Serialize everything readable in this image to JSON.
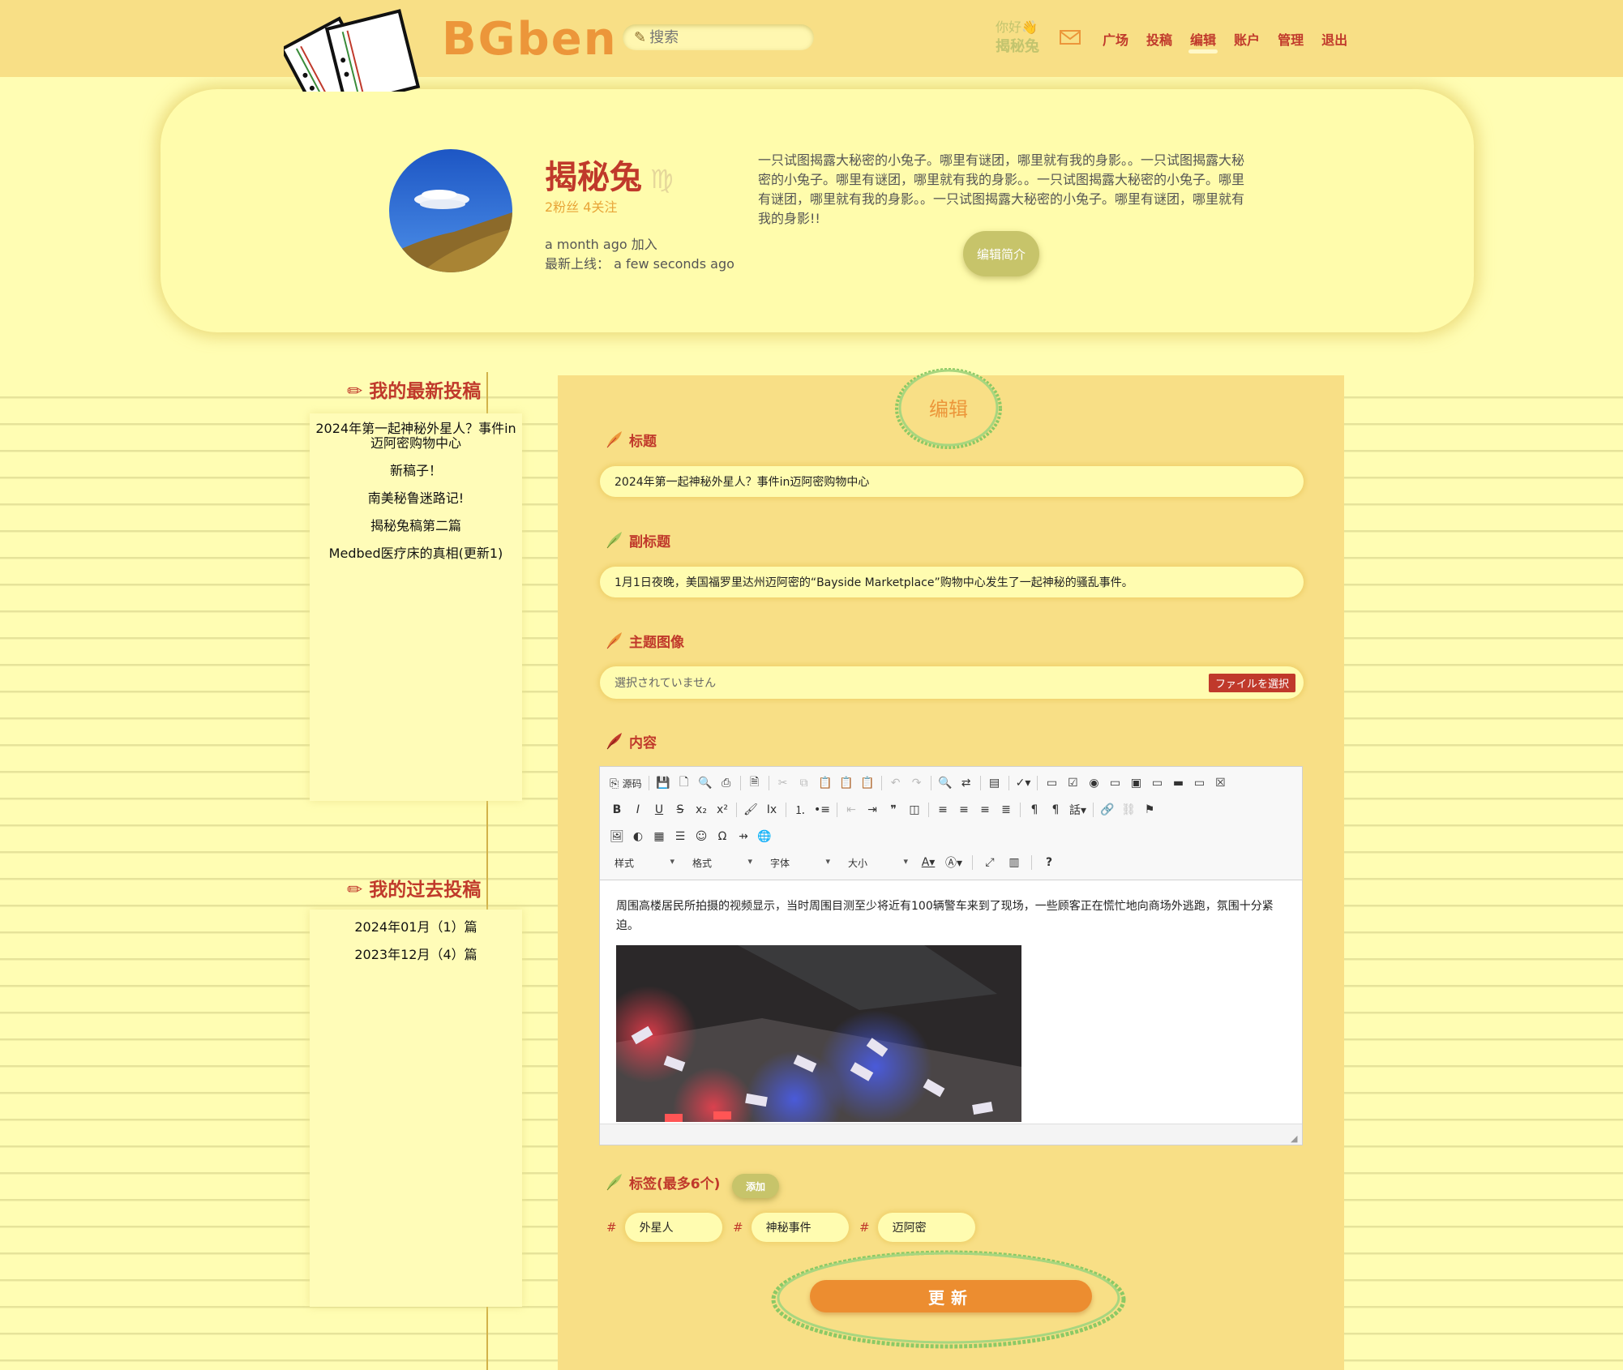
{
  "colors": {
    "page_bg": "#fffdb3",
    "header_bg": "#f8df86",
    "editor_bg": "#f8df86",
    "accent_red": "#c0392b",
    "accent_orange": "#ec963a",
    "olive_button": "#c7c46a",
    "green_scribble": "#8cc965"
  },
  "header": {
    "logo_text": "BGben",
    "search_placeholder": "搜索",
    "greeting": "你好👋",
    "username": "揭秘兔",
    "mail_icon": "envelope-icon",
    "nav": [
      {
        "label": "广场"
      },
      {
        "label": "投稿"
      },
      {
        "label": "编辑",
        "active": true
      },
      {
        "label": "账户"
      },
      {
        "label": "管理"
      },
      {
        "label": "退出"
      }
    ]
  },
  "profile": {
    "name": "揭秘兔",
    "zodiac": "♍",
    "stats": "2粉丝 4关注",
    "joined": "a month ago 加入",
    "last_online_label": "最新上线：",
    "last_online_value": "a few seconds ago",
    "bio": "一只试图揭露大秘密的小兔子。哪里有谜团，哪里就有我的身影。。一只试图揭露大秘密的小兔子。哪里有谜团，哪里就有我的身影。。一只试图揭露大秘密的小兔子。哪里有谜团，哪里就有我的身影。。一只试图揭露大秘密的小兔子。哪里有谜团，哪里就有我的身影!!",
    "edit_bio_label": "编辑简介"
  },
  "sidebar": {
    "latest_title": "我的最新投稿",
    "latest_items": [
      {
        "label": "2024年第一起神秘外星人？事件in迈阿密购物中心"
      },
      {
        "label": "新稿子！"
      },
      {
        "label": "南美秘鲁迷路记!"
      },
      {
        "label": "揭秘兔稿第二篇"
      },
      {
        "label": "Medbed医疗床的真相(更新1)"
      }
    ],
    "past_title": "我的过去投稿",
    "past_items": [
      {
        "label": "2024年01月（1）篇"
      },
      {
        "label": "2023年12月（4）篇"
      }
    ]
  },
  "editor": {
    "heading": "编辑",
    "title_label": "标题",
    "title_value": "2024年第一起神秘外星人？事件in迈阿密购物中心",
    "subtitle_label": "副标题",
    "subtitle_value": "1月1日夜晚，美国福罗里达州迈阿密的“Bayside Marketplace”购物中心发生了一起神秘的骚乱事件。",
    "image_label": "主题图像",
    "file_status": "選択されていません",
    "file_button": "ファイルを選択",
    "content_label": "内容",
    "toolbar": {
      "source_label": "源码",
      "style_label": "样式",
      "format_label": "格式",
      "font_label": "字体",
      "size_label": "大小"
    },
    "content_text": "周围高楼居民所拍摄的视频显示，当时周围目测至少将近有100辆警车来到了现场，一些顾客正在慌忙地向商场外逃跑，氛围十分紧迫。",
    "tags_label": "标签(最多6个)",
    "add_label": "添加",
    "tags": [
      {
        "label": "外星人"
      },
      {
        "label": "神秘事件"
      },
      {
        "label": "迈阿密"
      }
    ],
    "update_label": "更新"
  }
}
